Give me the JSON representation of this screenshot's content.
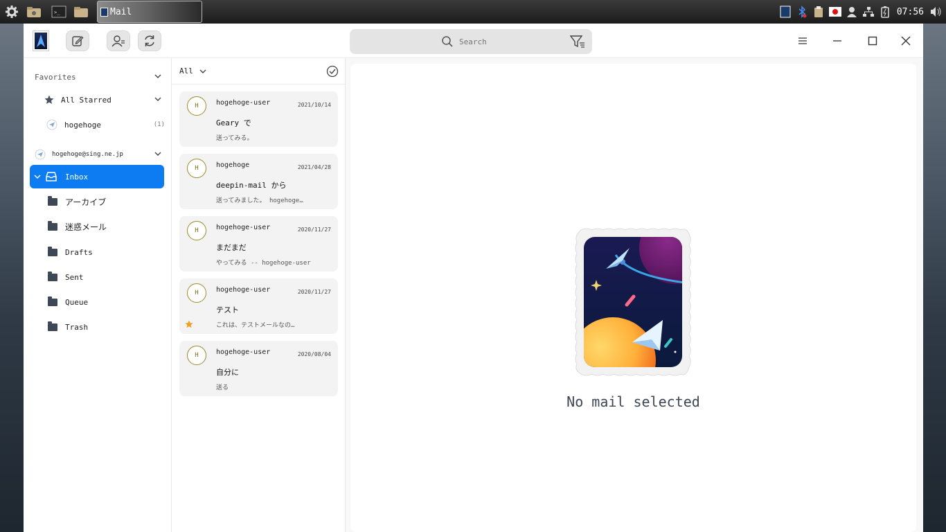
{
  "taskbar": {
    "task_label": "Mail",
    "clock": "07:56"
  },
  "toolbar": {
    "search_placeholder": "Search"
  },
  "sidebar": {
    "favorites_label": "Favorites",
    "all_starred_label": "All Starred",
    "favorite_account": {
      "label": "hogehoge",
      "count": "(1)"
    },
    "account_label": "hogehoge@sing.ne.jp",
    "inbox_label": "Inbox",
    "folders": [
      {
        "label": "アーカイブ"
      },
      {
        "label": "迷惑メール"
      },
      {
        "label": "Drafts"
      },
      {
        "label": "Sent"
      },
      {
        "label": "Queue"
      },
      {
        "label": "Trash"
      }
    ]
  },
  "list": {
    "filter_label": "All",
    "mails": [
      {
        "avatar": "H",
        "from": "hogehoge-user",
        "date": "2021/10/14",
        "subject": "Geary で",
        "preview": "送ってみる。",
        "starred": false
      },
      {
        "avatar": "H",
        "from": "hogehoge",
        "date": "2021/04/28",
        "subject": "deepin-mail から",
        "preview": "送ってみました。 hogehoge…",
        "starred": false
      },
      {
        "avatar": "H",
        "from": "hogehoge-user",
        "date": "2020/11/27",
        "subject": "まだまだ",
        "preview": "やってみる -- hogehoge-user",
        "starred": false
      },
      {
        "avatar": "H",
        "from": "hogehoge-user",
        "date": "2020/11/27",
        "subject": "テスト",
        "preview": "これは、テストメールなの…",
        "starred": true
      },
      {
        "avatar": "H",
        "from": "hogehoge-user",
        "date": "2020/08/04",
        "subject": "自分に",
        "preview": "送る",
        "starred": false
      }
    ]
  },
  "reader": {
    "empty_label": "No mail selected"
  },
  "colors": {
    "accent": "#0d7cf2",
    "star": "#f0a020"
  }
}
